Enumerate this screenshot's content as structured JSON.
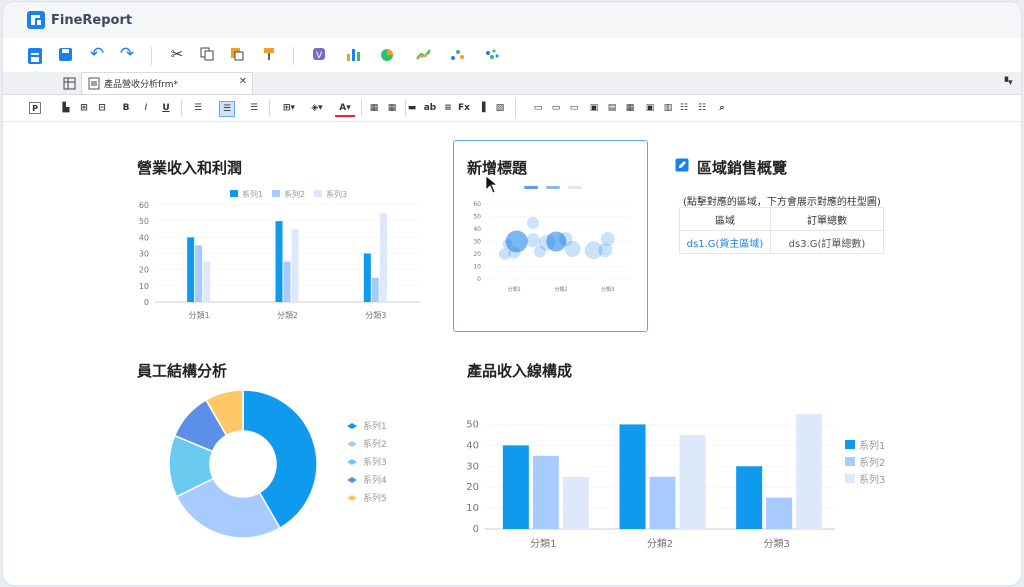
{
  "app": {
    "name": "FineReport"
  },
  "tab": {
    "label": "產品營收分析frm*"
  },
  "widgets": {
    "w1": {
      "title": "營業收入和利潤"
    },
    "w2": {
      "title": "新增標題"
    },
    "w3": {
      "title": "區域銷售概覽",
      "hint": "(點擊對應的區域，下方會展示對應的柱型圖)",
      "headers": [
        "區域",
        "訂單總數"
      ],
      "cells": [
        "ds1.G(貨主區域)",
        "ds3.G(訂單總數)"
      ]
    },
    "w4": {
      "title": "員工結構分析"
    },
    "w5": {
      "title": "產品收入線構成"
    }
  },
  "colors": {
    "s1": "#0f9aee",
    "s2": "#a8cbff",
    "s3": "#dde9fb",
    "pie": [
      "#0f9aee",
      "#a8cbff",
      "#6bcaf0",
      "#5b8fe8",
      "#ffc766"
    ]
  },
  "chart_data": [
    {
      "type": "bar",
      "categories": [
        "分類1",
        "分類2",
        "分類3"
      ],
      "series": [
        {
          "name": "系列1",
          "values": [
            40,
            50,
            30
          ]
        },
        {
          "name": "系列2",
          "values": [
            35,
            25,
            15
          ]
        },
        {
          "name": "系列3",
          "values": [
            25,
            45,
            55
          ]
        }
      ],
      "yticks": [
        0,
        10,
        20,
        30,
        40,
        50,
        60
      ],
      "ylim": [
        0,
        60
      ],
      "legend": "top"
    },
    {
      "type": "scatter",
      "categories": [
        "分類1",
        "分類2",
        "分類3"
      ],
      "yticks": [
        0,
        10,
        20,
        30,
        40,
        50,
        60
      ],
      "ylim": [
        0,
        60
      ],
      "points": [
        {
          "x": 0.35,
          "y": 28,
          "r": 5
        },
        {
          "x": 0.55,
          "y": 30,
          "r": 11
        },
        {
          "x": 0.5,
          "y": 21,
          "r": 6
        },
        {
          "x": 0.9,
          "y": 45,
          "r": 6
        },
        {
          "x": 0.9,
          "y": 31,
          "r": 7
        },
        {
          "x": 1.2,
          "y": 29,
          "r": 8
        },
        {
          "x": 1.4,
          "y": 30,
          "r": 10
        },
        {
          "x": 1.6,
          "y": 32,
          "r": 7
        },
        {
          "x": 1.75,
          "y": 24,
          "r": 8
        },
        {
          "x": 2.2,
          "y": 23,
          "r": 9
        },
        {
          "x": 2.45,
          "y": 23,
          "r": 7
        },
        {
          "x": 2.5,
          "y": 32,
          "r": 7
        },
        {
          "x": 0.3,
          "y": 20,
          "r": 6
        },
        {
          "x": 1.05,
          "y": 22,
          "r": 6
        }
      ]
    },
    {
      "type": "pie",
      "donut": true,
      "series": [
        {
          "name": "系列1",
          "value": 40
        },
        {
          "name": "系列2",
          "value": 25
        },
        {
          "name": "系列3",
          "value": 13
        },
        {
          "name": "系列4",
          "value": 10
        },
        {
          "name": "系列5",
          "value": 8
        }
      ]
    },
    {
      "type": "bar",
      "categories": [
        "分類1",
        "分類2",
        "分類3"
      ],
      "series": [
        {
          "name": "系列1",
          "values": [
            40,
            50,
            30
          ]
        },
        {
          "name": "系列2",
          "values": [
            35,
            25,
            15
          ]
        },
        {
          "name": "系列3",
          "values": [
            25,
            45,
            55
          ]
        }
      ],
      "yticks": [
        0,
        10,
        20,
        30,
        40,
        50
      ],
      "ylim": [
        0,
        55
      ],
      "legend": "right"
    }
  ]
}
